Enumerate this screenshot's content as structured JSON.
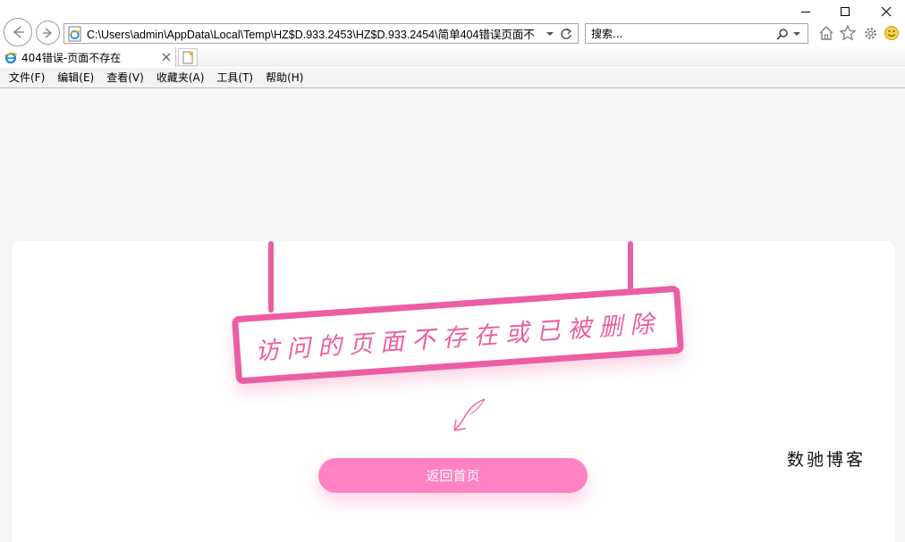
{
  "window": {
    "controls": {
      "minimize": "minimize-icon",
      "maximize": "maximize-icon",
      "close": "close-icon"
    }
  },
  "toolbar": {
    "address": "C:\\Users\\admin\\AppData\\Local\\Temp\\HZ$D.933.2453\\HZ$D.933.2454\\简单404错误页面不",
    "search_placeholder": "搜索...",
    "icons": [
      "back-icon",
      "forward-icon",
      "ie-page-icon",
      "dropdown-icon",
      "refresh-icon",
      "search-icon",
      "home-icon",
      "favorites-star-icon",
      "gear-icon",
      "smiley-icon"
    ]
  },
  "tabs": [
    {
      "label": "404错误-页面不存在",
      "active": true
    }
  ],
  "menu": [
    "文件(F)",
    "编辑(E)",
    "查看(V)",
    "收藏夹(A)",
    "工具(T)",
    "帮助(H)"
  ],
  "page": {
    "sign_text": "访问的页面不存在或已被删除",
    "home_button": "返回首页",
    "brand": "数驰博客",
    "colors": {
      "accent": "#ec5ea3",
      "button": "#ff82c3",
      "background": "#f6f4f5"
    }
  }
}
